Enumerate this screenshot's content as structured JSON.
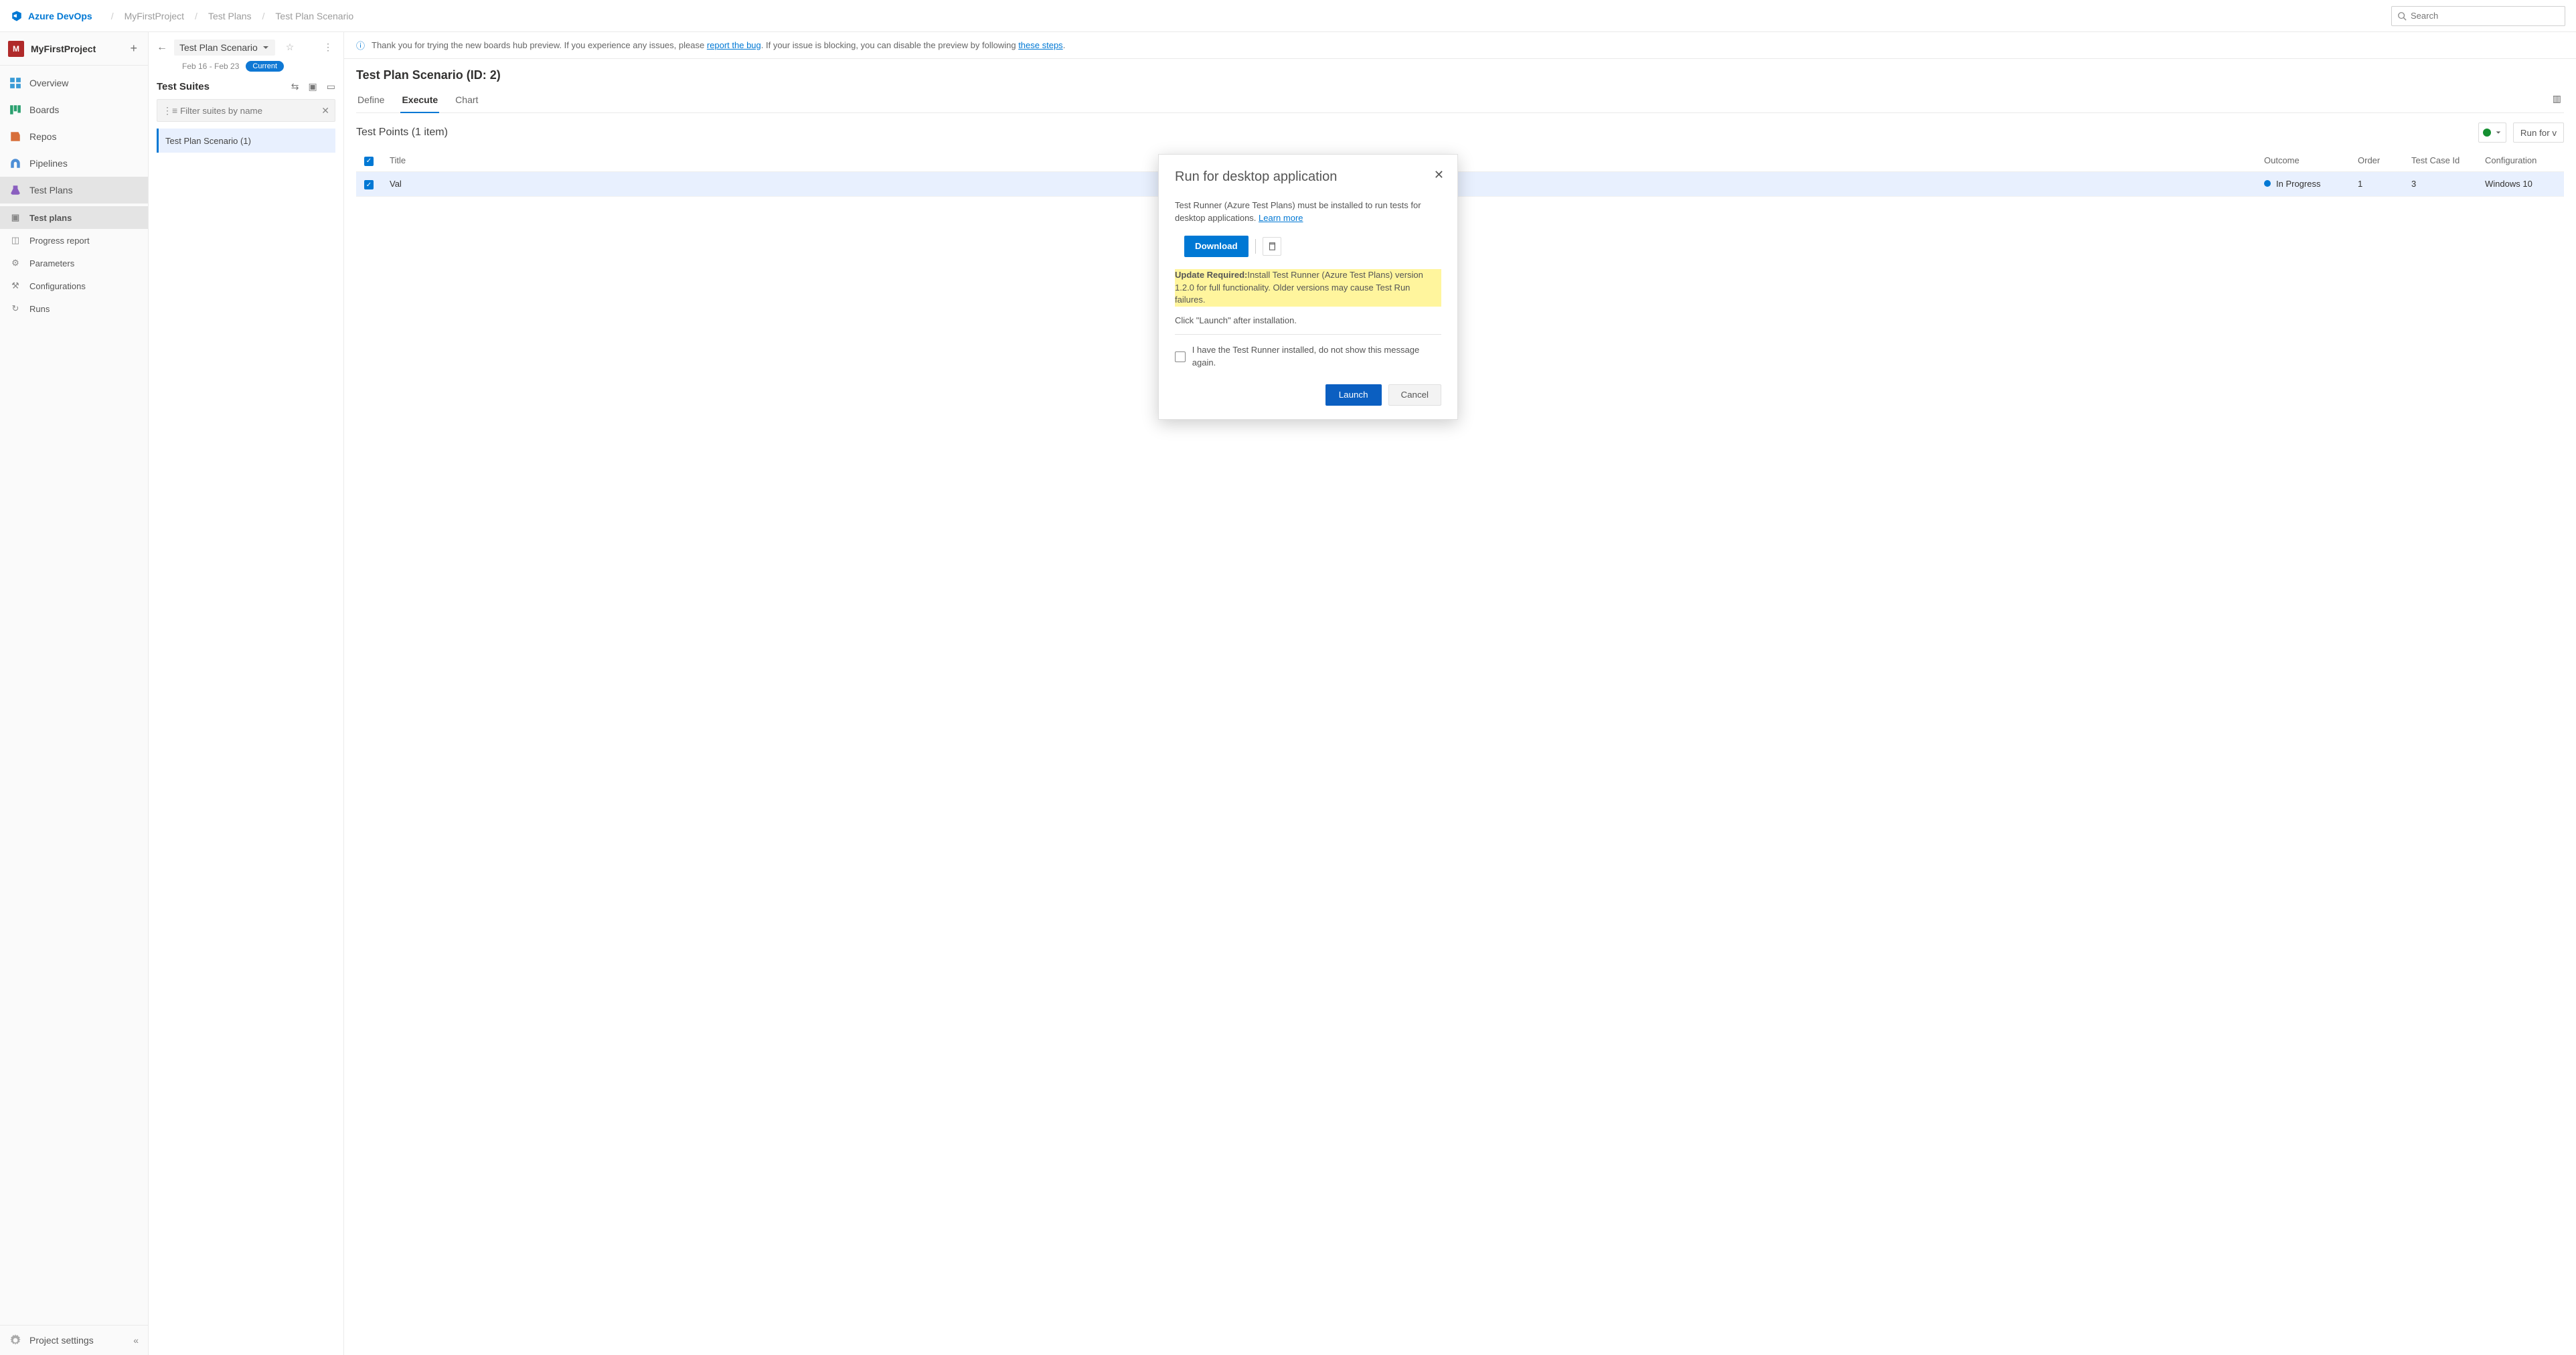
{
  "brand": "Azure DevOps",
  "breadcrumbs": [
    "MyFirstProject",
    "Test Plans",
    "Test Plan Scenario"
  ],
  "search": {
    "placeholder": "Search"
  },
  "project": {
    "initial": "M",
    "name": "MyFirstProject"
  },
  "nav": {
    "overview": "Overview",
    "boards": "Boards",
    "repos": "Repos",
    "pipelines": "Pipelines",
    "testplans": "Test Plans",
    "sub": {
      "testplans": "Test plans",
      "progress": "Progress report",
      "parameters": "Parameters",
      "configurations": "Configurations",
      "runs": "Runs"
    },
    "settings": "Project settings"
  },
  "suite": {
    "plan_name": "Test Plan Scenario",
    "dates": "Feb 16 - Feb 23",
    "current": "Current",
    "title": "Test Suites",
    "filter_placeholder": "Filter suites by name",
    "item": "Test Plan Scenario (1)"
  },
  "banner": {
    "pre": "Thank you for trying the new boards hub preview. If you experience any issues, please ",
    "link1": "report the bug",
    "mid": ". If your issue is blocking, you can disable the preview by following ",
    "link2": "these steps",
    "post": "."
  },
  "main": {
    "title": "Test Plan Scenario (ID: 2)",
    "tabs": {
      "define": "Define",
      "execute": "Execute",
      "chart": "Chart"
    },
    "test_points_title": "Test Points (1 item)",
    "run_button": "Run for v",
    "columns": {
      "title": "Title",
      "outcome": "Outcome",
      "order": "Order",
      "tcid": "Test Case Id",
      "config": "Configuration"
    },
    "row": {
      "title": "Val",
      "outcome": "In Progress",
      "order": "1",
      "tcid": "3",
      "config": "Windows 10"
    }
  },
  "dialog": {
    "title": "Run for desktop application",
    "line1a": "Test Runner (Azure Test Plans) must be installed to run tests for desktop applications. ",
    "learn_more": "Learn more",
    "download": "Download",
    "update_strong": "Update Required:",
    "update_rest": "Install Test Runner (Azure Test Plans) version 1.2.0 for full functionality. Older versions may cause Test Run failures.",
    "launch_hint": "Click \"Launch\" after installation.",
    "dont_show": "I have the Test Runner installed, do not show this message again.",
    "launch": "Launch",
    "cancel": "Cancel"
  }
}
